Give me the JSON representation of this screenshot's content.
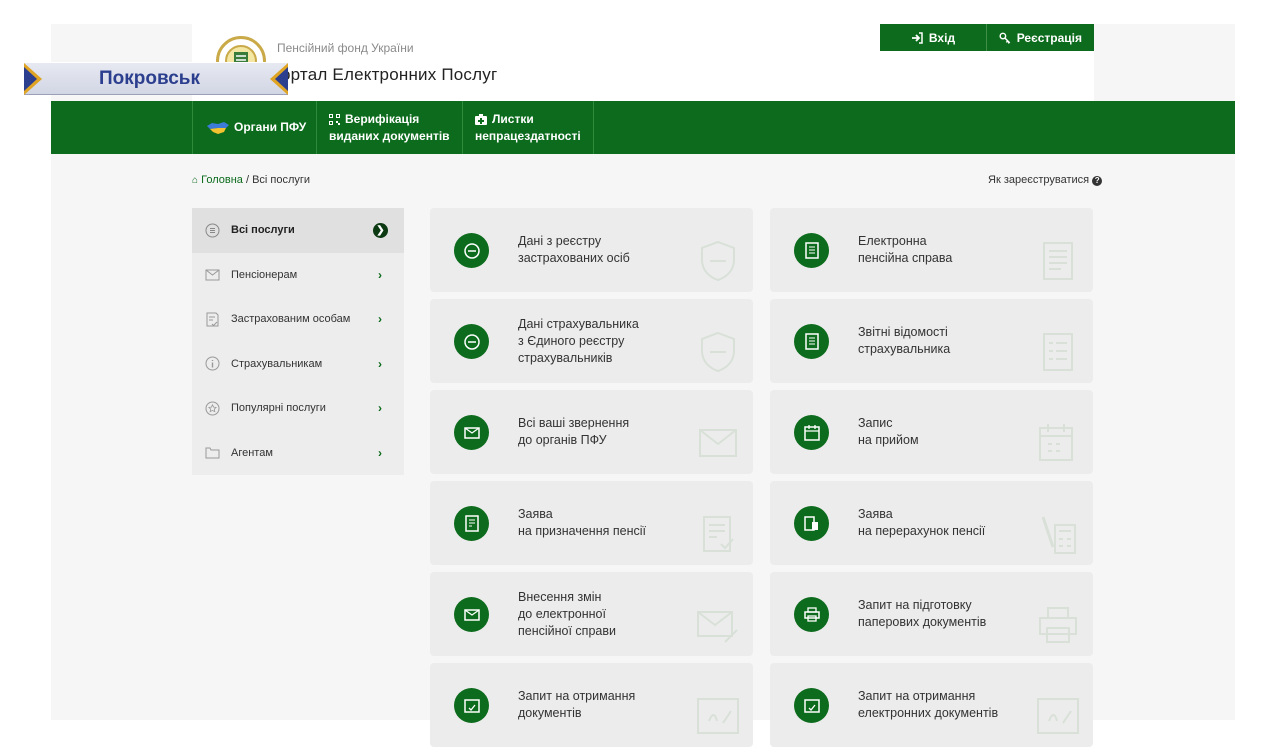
{
  "header": {
    "org_name": "Пенсійний фонд України",
    "portal_title": "ортал Електронних Послуг",
    "login_label": "Вхід",
    "register_label": "Реєстрація"
  },
  "city_overlay": {
    "name": "Покровськ"
  },
  "nav": {
    "items": [
      {
        "line1": "Органи ПФУ",
        "line2": ""
      },
      {
        "line1": "Верифікація",
        "line2": "виданих документів"
      },
      {
        "line1": "Листки",
        "line2": "непрацездатності"
      }
    ]
  },
  "breadcrumb": {
    "home": "Головна",
    "separator": " / ",
    "current": "Всі послуги"
  },
  "help_link": "Як зареєструватися",
  "sidebar": {
    "items": [
      {
        "label": "Всі послуги",
        "icon": "list-icon",
        "active": true
      },
      {
        "label": "Пенсіонерам",
        "icon": "envelope-icon"
      },
      {
        "label": "Застрахованим особам",
        "icon": "document-check-icon"
      },
      {
        "label": "Страхувальникам",
        "icon": "info-icon"
      },
      {
        "label": "Популярні послуги",
        "icon": "star-icon"
      },
      {
        "label": "Агентам",
        "icon": "folder-icon"
      }
    ]
  },
  "services": [
    {
      "lines": [
        "Дані з реєстру",
        "застрахованих осіб"
      ],
      "icon": "shield-icon"
    },
    {
      "lines": [
        "Електронна",
        "пенсійна справа"
      ],
      "icon": "file-icon"
    },
    {
      "lines": [
        "Дані страхувальника",
        "з Єдиного реєстру",
        "страхувальників"
      ],
      "icon": "shield-icon"
    },
    {
      "lines": [
        "Звітні відомості",
        "страхувальника"
      ],
      "icon": "report-icon"
    },
    {
      "lines": [
        "Всі ваші звернення",
        "до органів ПФУ"
      ],
      "icon": "envelope-icon"
    },
    {
      "lines": [
        "Запис",
        "на прийом"
      ],
      "icon": "calendar-icon"
    },
    {
      "lines": [
        "Заява",
        "на призначення пенсії"
      ],
      "icon": "application-icon"
    },
    {
      "lines": [
        "Заява",
        "на перерахунок пенсії"
      ],
      "icon": "calculator-icon"
    },
    {
      "lines": [
        "Внесення змін",
        "до електронної",
        "пенсійної справи"
      ],
      "icon": "envelope-edit-icon"
    },
    {
      "lines": [
        "Запит на підготовку",
        "паперових документів"
      ],
      "icon": "printer-icon"
    },
    {
      "lines": [
        "Запит на отримання",
        "документів"
      ],
      "icon": "certificate-icon"
    },
    {
      "lines": [
        "Запит на отримання",
        "електронних документів"
      ],
      "icon": "certificate-icon"
    }
  ],
  "colors": {
    "brand_green": "#0c6b1c",
    "overlay_blue": "#2c3f8e",
    "overlay_gold": "#e0a424"
  }
}
